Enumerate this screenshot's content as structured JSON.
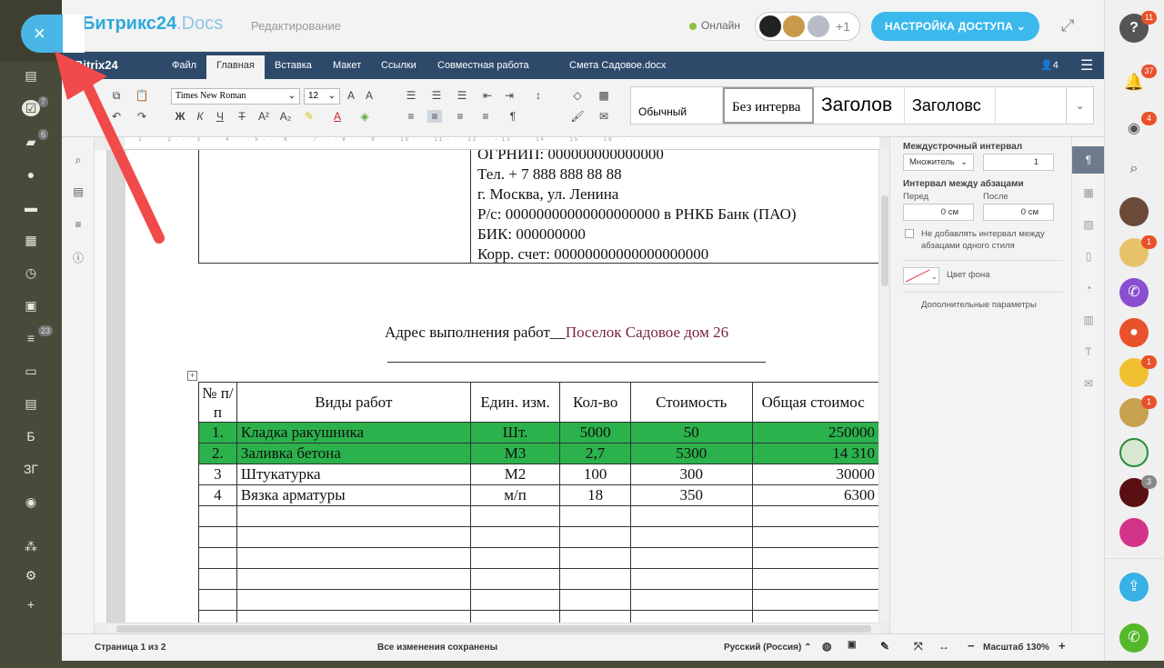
{
  "header": {
    "logo_main": "Битрикс24",
    "logo_docs": ".Docs",
    "mode": "Редактирование",
    "online": "Онлайн",
    "participants_extra": "+1",
    "access_button": "НАСТРОЙКА ДОСТУПА"
  },
  "close_button": "×",
  "left_bar": {
    "badges": [
      "7",
      "6",
      "23"
    ],
    "letters": [
      "Б",
      "ЗГ"
    ]
  },
  "menubar": {
    "logo": "Bitrix24",
    "items": [
      "Файл",
      "Главная",
      "Вставка",
      "Макет",
      "Ссылки",
      "Совместная работа"
    ],
    "active": "Главная",
    "doc_title": "Смета Садовое.docx",
    "users_count": "4"
  },
  "toolbar": {
    "font": "Times New Roman",
    "size": "12",
    "bold": "Ж",
    "italic": "К",
    "underline": "Ч",
    "strike": "Т",
    "super": "A²",
    "sub": "A₂",
    "styles": [
      "Обычный",
      "Без интерва",
      "Заголов",
      "Заголовс"
    ]
  },
  "document": {
    "requisites": [
      "ОГРНИП: 000000000000000",
      "Тел. + 7 888 888 88 88",
      "г. Москва, ул. Ленина",
      "Р/с: 00000000000000000000 в РНКБ Банк (ПАО)",
      "БИК: 000000000",
      "Корр. счет: 00000000000000000000"
    ],
    "address_label": "Адрес выполнения работ",
    "address_value": "Поселок Садовое дом 26",
    "table": {
      "headers": [
        "№ п/п",
        "Виды работ",
        "Един. изм.",
        "Кол-во",
        "Стоимость",
        "Общая стоимос"
      ],
      "rows": [
        [
          "1.",
          "Кладка ракушника",
          "Шт.",
          "5000",
          "50",
          "250000"
        ],
        [
          "2.",
          "Заливка бетона",
          "М3",
          "2,7",
          "5300",
          "14 310"
        ],
        [
          "3",
          "Штукатурка",
          "М2",
          "100",
          "300",
          "30000"
        ],
        [
          "4",
          "Вязка арматуры",
          "м/п",
          "18",
          "350",
          "6300"
        ]
      ]
    }
  },
  "panel": {
    "line_spacing_label": "Междустрочный интервал",
    "line_spacing_type": "Множитель",
    "line_spacing_value": "1",
    "para_spacing_label": "Интервал между абзацами",
    "before_label": "Перед",
    "after_label": "После",
    "before_value": "0 см",
    "after_value": "0 см",
    "no_add_interval": "Не добавлять интервал между абзацами одного стиля",
    "bg_color": "Цвет фона",
    "more_params": "Дополнительные параметры"
  },
  "status": {
    "page": "Страница 1 из 2",
    "saved": "Все изменения сохранены",
    "language": "Русский (Россия)",
    "zoom": "Масштаб 130%"
  },
  "right_bar": {
    "badges": [
      "11",
      "37",
      "4",
      "1",
      "1",
      "1",
      "3"
    ]
  },
  "colors": {
    "accent": "#3bb9ec",
    "menubar": "#2e4a6b",
    "highlight": "#2bb24c",
    "arrow": "#f04a4a"
  }
}
